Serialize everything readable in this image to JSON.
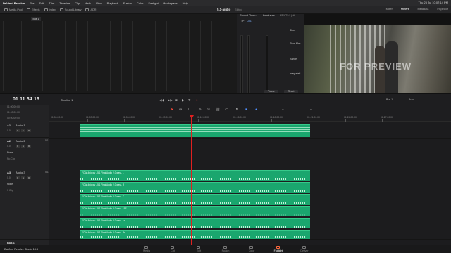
{
  "menubar": {
    "app": "DaVinci Resolve",
    "items": [
      "File",
      "Edit",
      "Trim",
      "Timeline",
      "Clip",
      "Mark",
      "View",
      "Playback",
      "Fusion",
      "Color",
      "Fairlight",
      "Workspace",
      "Help"
    ],
    "clock": "Thu 25 Jul 10:07:14 PM"
  },
  "toolbar": {
    "media_pool": "Media Pool",
    "effects": "Effects",
    "index": "Index",
    "sound_library": "Sound Library",
    "adr": "ADR",
    "project_title": "5.1-audio",
    "edited": "Edited",
    "mixer": "Mixer",
    "meters": "Meters",
    "metadata": "Metadata",
    "inspector": "Inspector"
  },
  "meters": {
    "bus_label": "Bus 1"
  },
  "control_room": {
    "title": "Control Room",
    "tp": "TP",
    "bus": "CR1",
    "loudness": "Loudness",
    "standard": "BS.1770-1 (LU)",
    "short": "Short",
    "short_max": "Short Max",
    "range": "Range",
    "integrated": "Integrated",
    "pause": "Pause",
    "reset": "Reset"
  },
  "viewer": {
    "watermark": "FOR PREVIEW"
  },
  "timeline_header": {
    "timecode": "01:11:34:16",
    "timeline_name": "Timeline 1",
    "bus_out": "Bus 1",
    "auto": "Auto"
  },
  "timecodes": [
    "01:00:00:00",
    "01:00:00:00",
    "00:00:00:00"
  ],
  "tracks": [
    {
      "id": "A1",
      "name": "Audio 1",
      "vol": "0.0",
      "channels": ""
    },
    {
      "id": "A2",
      "name": "Audio 2",
      "vol": "0.0",
      "channels": "5.1",
      "fx": "None",
      "clips": "No Clip"
    },
    {
      "id": "A3",
      "name": "Audio 3",
      "vol": "0.0",
      "channels": "5.1",
      "fx": "None",
      "clips": "1 Clip"
    },
    {
      "id": "Bus 1",
      "name": "",
      "vol": "",
      "channels": ""
    }
  ],
  "ruler": [
    "01:00:00:00",
    "01:03:00:00",
    "01:06:00:00",
    "01:09:00:00",
    "01:12:00:00",
    "01:15:00:00",
    "01:18:00:00",
    "01:21:00:00",
    "01:24:00:00",
    "01:27:00:00"
  ],
  "clips": [
    "FOW-4pid.wv - 5.1 Final Audio 2.0.wav - L",
    "FOW-4pid.wv - 5.1 Final Audio 2.0.wav - R",
    "FOW-4pid.wv - 5.1 Final Audio 2.0.wav - C",
    "FOW-4pid.wv - 5.1 Final Audio 2.0.wav - LFE",
    "FOW-4pid.wv - 5.1 Final Audio 2.0.wav - Ls",
    "FOW-4pid.wv - 5.1 Final Audio 2.0.wav - Rs"
  ],
  "pagebar": {
    "brand": "DaVinci Resolve Studio 18.6",
    "pages": [
      "Media",
      "Cut",
      "Edit",
      "Fusion",
      "Color",
      "Fairlight",
      "Deliver"
    ],
    "active": "Fairlight"
  },
  "colors": {
    "clip": "#1aa66e",
    "playhead": "#e02020",
    "accent": "#ff6a3d"
  }
}
